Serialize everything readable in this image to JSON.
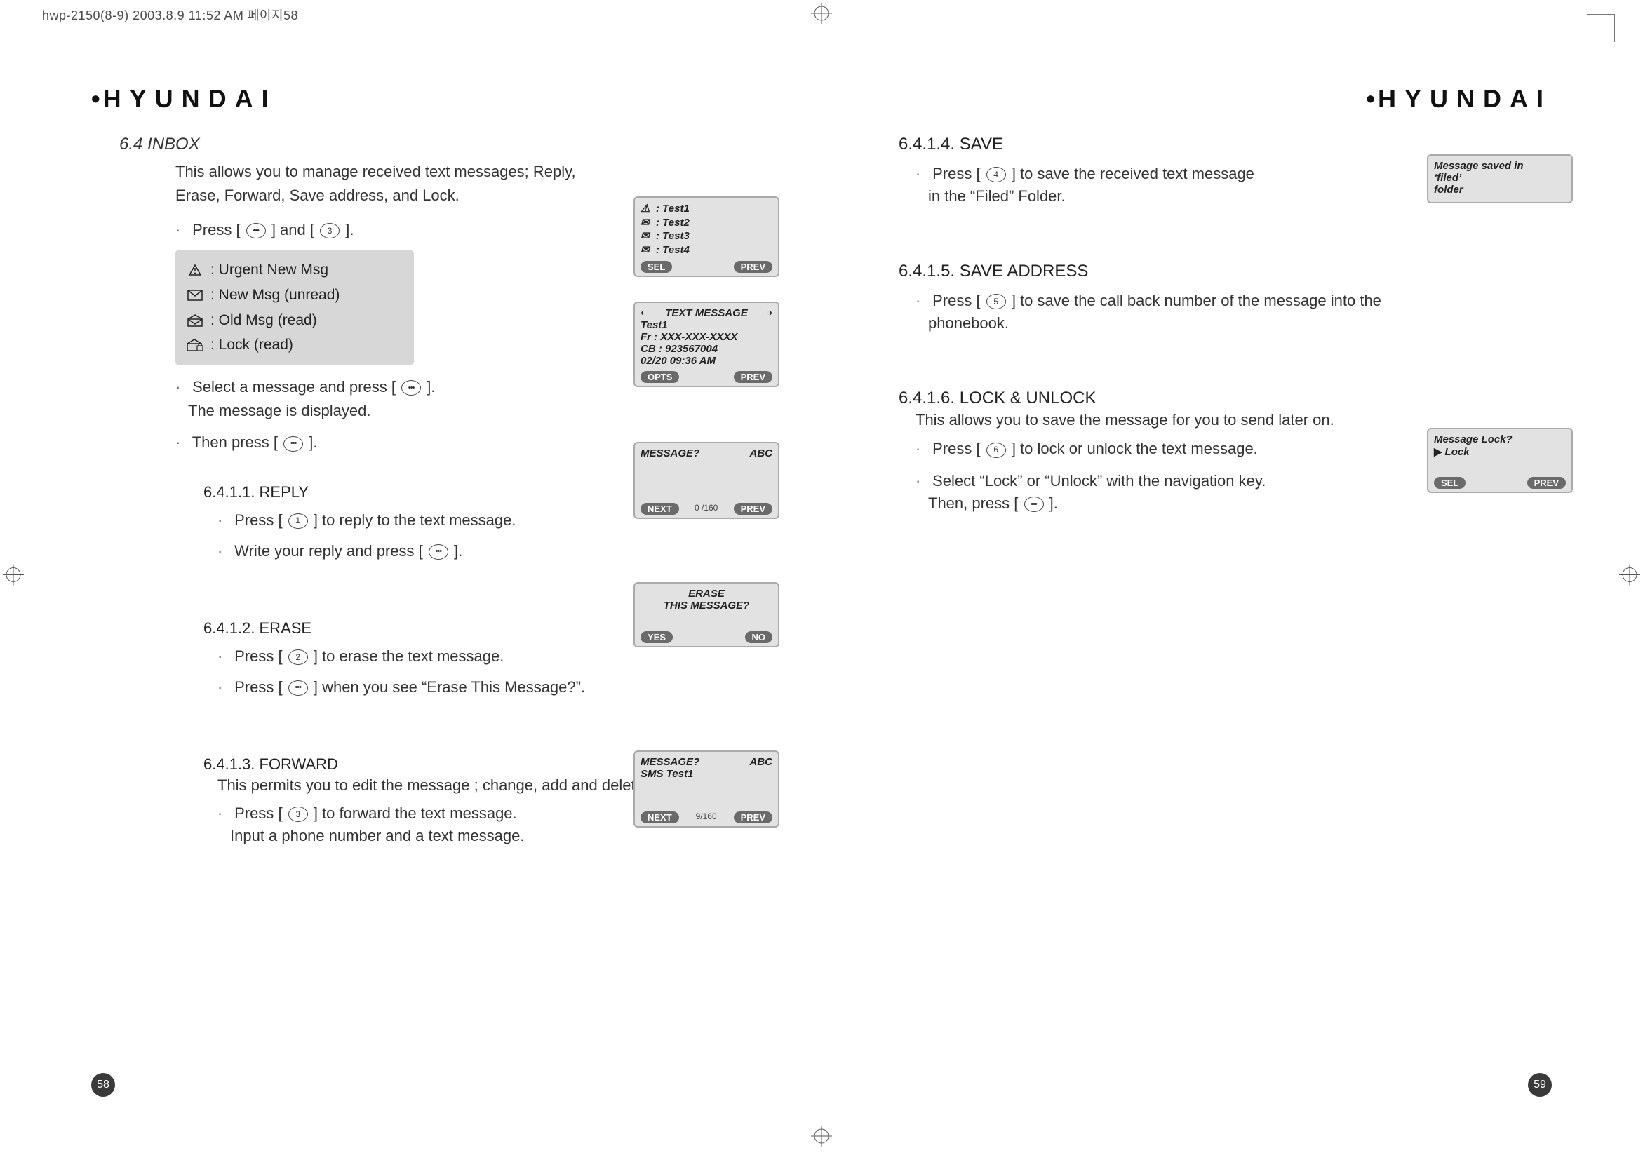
{
  "meta": {
    "file_header": "hwp-2150(8-9)  2003.8.9 11:52 AM 페이지58"
  },
  "brand": "HYUNDAI",
  "page_numbers": {
    "left": "58",
    "right": "59"
  },
  "left_page": {
    "title": "6.4 INBOX",
    "intro": "This allows you to manage received text messages; Reply, Erase, Forward, Save address, and Lock.",
    "step1_a": "Press [",
    "step1_b": "] and [",
    "step1_c": "].",
    "legend": [
      {
        "icon": "alert-triangle-icon",
        "label": ": Urgent New Msg"
      },
      {
        "icon": "mail-closed-icon",
        "label": ": New Msg (unread)"
      },
      {
        "icon": "mail-open-icon",
        "label": ": Old Msg (read)"
      },
      {
        "icon": "mail-lock-icon",
        "label": ": Lock (read)"
      }
    ],
    "step2_a": "Select a message and press [",
    "step2_b": "].",
    "step2_note": "The message is displayed.",
    "step3_a": "Then press [",
    "step3_b": "].",
    "reply": {
      "head": "6.4.1.1. REPLY",
      "s1a": "Press [",
      "s1b": "] to reply to the text message.",
      "s2a": "Write your reply and press [",
      "s2b": "]."
    },
    "erase": {
      "head": "6.4.1.2. ERASE",
      "s1a": "Press [",
      "s1b": "] to erase the text message.",
      "s2a": "Press [",
      "s2b": "] when you see “Erase This Message?”."
    },
    "forward": {
      "head": "6.4.1.3. FORWARD",
      "desc": "This permits you to edit the message ; change, add and delete.",
      "s1a": "Press [",
      "s1b": "] to forward the text message.",
      "s1_note": "Input a phone number and a text message."
    },
    "phone_list": {
      "rows": [
        ": Test1",
        ": Test2",
        ": Test3",
        ": Test4"
      ],
      "sk_left": "SEL",
      "sk_right": "PREV"
    },
    "phone_detail": {
      "title": "TEXT MESSAGE",
      "line1": "Test1",
      "line2": "Fr : XXX-XXX-XXXX",
      "line3": "CB : 923567004",
      "line4": "02/20 09:36 AM",
      "sk_left": "OPTS",
      "sk_right": "PREV"
    },
    "phone_reply": {
      "left": "MESSAGE?",
      "right": "ABC",
      "counter": "0 /160",
      "sk_left": "NEXT",
      "sk_right": "PREV"
    },
    "phone_erase": {
      "line1": "ERASE",
      "line2": "THIS MESSAGE?",
      "sk_left": "YES",
      "sk_right": "NO"
    },
    "phone_forward": {
      "left": "MESSAGE?",
      "right": "ABC",
      "body": "SMS Test1",
      "counter": "9/160",
      "sk_left": "NEXT",
      "sk_right": "PREV"
    }
  },
  "right_page": {
    "save": {
      "head": "6.4.1.4. SAVE",
      "s1a": "Press [",
      "s1b": "] to save the received text message",
      "note": "in the “Filed” Folder."
    },
    "save_addr": {
      "head": "6.4.1.5. SAVE ADDRESS",
      "s1a": "Press [",
      "s1b": "] to save the call back number of the message into the",
      "note": "phonebook."
    },
    "lock": {
      "head": "6.4.1.6. LOCK & UNLOCK",
      "desc": "This allows you to save the message for you to send later on.",
      "s1a": "Press [",
      "s1b": "] to lock or unlock the text message.",
      "s2": "Select “Lock” or “Unlock” with the navigation key.",
      "s2_note_a": "Then, press [",
      "s2_note_b": "]."
    },
    "phone_saved": {
      "line1": "Message saved in",
      "line2": "‘filed’",
      "line3": "folder"
    },
    "phone_lock": {
      "line1": "Message Lock?",
      "line2": "Lock",
      "sk_left": "SEL",
      "sk_right": "PREV"
    }
  },
  "keys": {
    "num1": "1",
    "num2": "2",
    "num3": "3",
    "num4": "4",
    "num5": "5",
    "num6": "6"
  }
}
